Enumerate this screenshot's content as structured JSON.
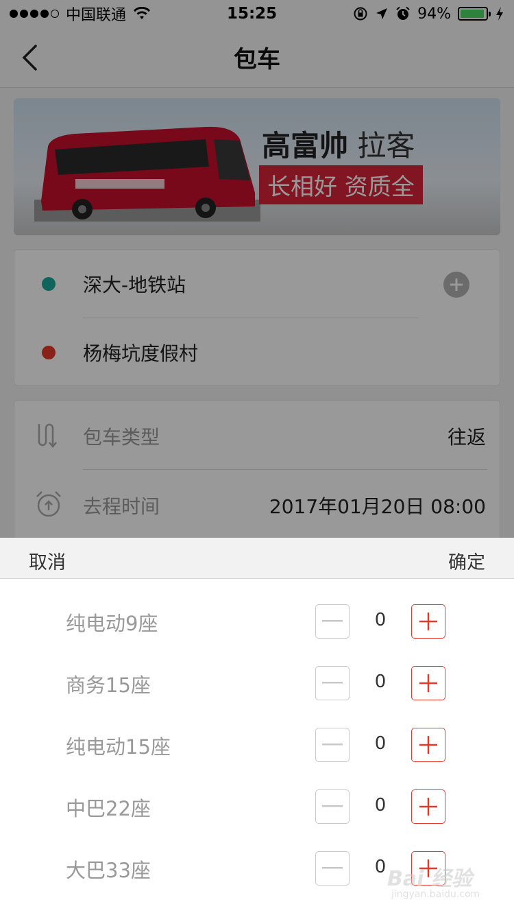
{
  "status_bar": {
    "carrier": "中国联通",
    "time": "15:25",
    "battery": "94%",
    "battery_level": 0.94,
    "icons": [
      "signal-dots-icon",
      "wifi-icon",
      "orientation-lock-icon",
      "location-arrow-icon",
      "alarm-icon",
      "battery-icon",
      "charging-bolt-icon"
    ]
  },
  "nav": {
    "title": "包车",
    "back_icon": "chevron-left-icon"
  },
  "banner": {
    "headline_bold": "高富帅",
    "headline_light": " 拉客",
    "tag": "长相好 资质全",
    "tag_color": "#d9233a"
  },
  "route": {
    "start": "深大-地铁站",
    "end": "杨梅坑度假村",
    "start_color": "#1aa79b",
    "end_color": "#e33a2b",
    "add_icon": "plus-circle-icon"
  },
  "options": [
    {
      "label": "包车类型",
      "value": "往返",
      "icon": "round-trip-icon"
    },
    {
      "label": "去程时间",
      "value": "2017年01月20日 08:00",
      "icon": "alarm-clock-icon"
    }
  ],
  "sheet": {
    "cancel": "取消",
    "confirm": "确定",
    "vehicles": [
      {
        "name": "纯电动9座",
        "count": "0"
      },
      {
        "name": "商务15座",
        "count": "0"
      },
      {
        "name": "纯电动15座",
        "count": "0"
      },
      {
        "name": "中巴22座",
        "count": "0"
      },
      {
        "name": "大巴33座",
        "count": "0"
      }
    ],
    "accent_color": "#e33a2b"
  },
  "watermark": {
    "text": "Bai 经验",
    "sub": "jingyan.baidu.com"
  }
}
